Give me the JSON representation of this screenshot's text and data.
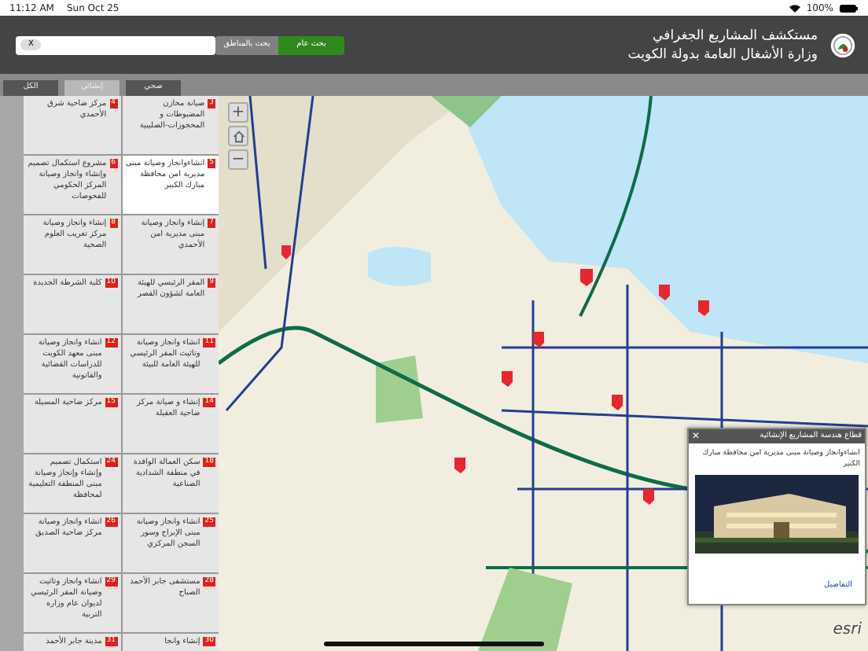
{
  "status_bar": {
    "time": "11:12 AM",
    "date": "Sun Oct 25",
    "battery": "100%"
  },
  "header": {
    "title": "مستكشف المشاريع الجغرافي",
    "subtitle": "وزارة الأشغال العامة بدولة الكويت",
    "search_buttons": [
      {
        "label": "بحث عام",
        "selected": true
      },
      {
        "label": "بحث بالمناطق",
        "selected": false
      }
    ],
    "search": {
      "clear": "X"
    }
  },
  "tabs": [
    {
      "label": "صحي",
      "selected": false
    },
    {
      "label": "إنشائي",
      "selected": true
    },
    {
      "label": "الكل",
      "selected": false
    }
  ],
  "projects": [
    {
      "number": "3",
      "name": "صيانة مخازن المضبوطات و المحجوزات-الصليبية",
      "selected": false
    },
    {
      "number": "4",
      "name": "مركز ضاحية شرق الأحمدي",
      "selected": false
    },
    {
      "number": "5",
      "name": "انشاءوانجاز وصيانة مبنى مديرية امن محافظة مبارك الكبير",
      "selected": true
    },
    {
      "number": "6",
      "name": "مشروع استكمال تصميم وإنشاء وانجاز وصيانة المركز الحكومي للفحوصات",
      "selected": false
    },
    {
      "number": "7",
      "name": "إنشاء وانجاز وصيانة مبنى مديرية امن الأحمدي",
      "selected": false
    },
    {
      "number": "8",
      "name": "إنشاء وانجاز وصيانة مركز تعريب العلوم الصحية",
      "selected": false
    },
    {
      "number": "9",
      "name": "المقر الرئيسي للهيئة العامة لشؤون القصر",
      "selected": false
    },
    {
      "number": "10",
      "name": "كلية الشرطة الجديدة",
      "selected": false
    },
    {
      "number": "11",
      "name": "انشاء وانجاز وصيانة وتاثيث المقر الرئيسي للهيئة العامة للبيئة",
      "selected": false
    },
    {
      "number": "12",
      "name": "انشاء وانجاز وصيانة مبنى معهد الكويت للدراسات القضائية والقانونية",
      "selected": false
    },
    {
      "number": "14",
      "name": "إنشاء و صيانة مركز ضاحية العقيلة",
      "selected": false
    },
    {
      "number": "15",
      "name": "مركز ضاحية المسيلة",
      "selected": false
    },
    {
      "number": "18",
      "name": "سكن العمالة الوافدة في منطقة الشدادية الصناعية",
      "selected": false
    },
    {
      "number": "24",
      "name": "استكمال تصميم وإنشاء وإنجاز وصيانة مبنى المنطقة التعليمية لمحافظة",
      "selected": false
    },
    {
      "number": "25",
      "name": "انشاء وانجاز وصيانة مبنى الإبراج وسور السجن المركزي",
      "selected": false
    },
    {
      "number": "26",
      "name": "انشاء وانجاز وصيانة مركز ضاحية الصديق",
      "selected": false
    },
    {
      "number": "28",
      "name": "مستشفى جابر الأحمد الصباح",
      "selected": false
    },
    {
      "number": "29",
      "name": "انشاء وانجاز وتاثيث وصيانة المقر الرئيسي لديوان عام وزارة التربية",
      "selected": false
    },
    {
      "number": "30",
      "name": "إنشاء وانجا",
      "selected": false
    },
    {
      "number": "31",
      "name": "مدينة جابر الأحمد",
      "selected": false
    }
  ],
  "map": {
    "zoom_in": "+",
    "zoom_out": "−",
    "attribution": "esri"
  },
  "popup": {
    "title": "قطاع هندسة المشاريع الإنشائية",
    "close": "✕",
    "description": "انشاءوانجاز وصيانة مبنى مديرية امن محافظة مبارك الكبير",
    "link": "التفاصيل"
  }
}
